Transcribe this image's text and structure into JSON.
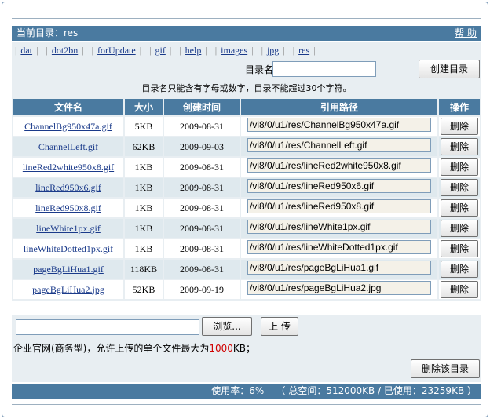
{
  "header": {
    "current_dir_label": "当前目录：res",
    "help_label": "帮 助"
  },
  "subdirs": [
    "dat",
    "dot2bn",
    "forUpdate",
    "gif",
    "help",
    "images",
    "jpg",
    "res"
  ],
  "create_dir": {
    "label": "目录名：",
    "value": "",
    "button_label": "创建目录",
    "hint": "目录名只能含有字母或数字，目录不能超过30个字符。"
  },
  "table": {
    "headers": [
      "文件名",
      "大小",
      "创建时间",
      "引用路径",
      "操作"
    ],
    "rows": [
      {
        "name": "ChannelBg950x47a.gif",
        "size": "5KB",
        "date": "2009-08-31",
        "path": "/vi8/0/u1/res/ChannelBg950x47a.gif",
        "action": "删除"
      },
      {
        "name": "ChannelLeft.gif",
        "size": "62KB",
        "date": "2009-09-03",
        "path": "/vi8/0/u1/res/ChannelLeft.gif",
        "action": "删除"
      },
      {
        "name": "lineRed2white950x8.gif",
        "size": "1KB",
        "date": "2009-08-31",
        "path": "/vi8/0/u1/res/lineRed2white950x8.gif",
        "action": "删除"
      },
      {
        "name": "lineRed950x6.gif",
        "size": "1KB",
        "date": "2009-08-31",
        "path": "/vi8/0/u1/res/lineRed950x6.gif",
        "action": "删除"
      },
      {
        "name": "lineRed950x8.gif",
        "size": "1KB",
        "date": "2009-08-31",
        "path": "/vi8/0/u1/res/lineRed950x8.gif",
        "action": "删除"
      },
      {
        "name": "lineWhite1px.gif",
        "size": "1KB",
        "date": "2009-08-31",
        "path": "/vi8/0/u1/res/lineWhite1px.gif",
        "action": "删除"
      },
      {
        "name": "lineWhiteDotted1px.gif",
        "size": "1KB",
        "date": "2009-08-31",
        "path": "/vi8/0/u1/res/lineWhiteDotted1px.gif",
        "action": "删除"
      },
      {
        "name": "pageBgLiHua1.gif",
        "size": "118KB",
        "date": "2009-08-31",
        "path": "/vi8/0/u1/res/pageBgLiHua1.gif",
        "action": "删除"
      },
      {
        "name": "pageBgLiHua2.jpg",
        "size": "52KB",
        "date": "2009-09-19",
        "path": "/vi8/0/u1/res/pageBgLiHua2.jpg",
        "action": "删除"
      }
    ]
  },
  "upload": {
    "file_value": "",
    "browse_label": "浏览...",
    "upload_label": "上 传",
    "note_prefix": "企业官网(商务型)，允许上传的单个文件最大为",
    "note_limit": "1000",
    "note_suffix": "KB；",
    "delete_dir_label": "删除该目录"
  },
  "footer": {
    "usage_text": "使用率：6%    （ 总空间：512000KB / 已使用：23259KB ）"
  },
  "colors": {
    "bar": "#4a7aa0",
    "panel": "#e8eef2",
    "row_alt": "#dfe9ee",
    "limit_red": "#d00000"
  }
}
